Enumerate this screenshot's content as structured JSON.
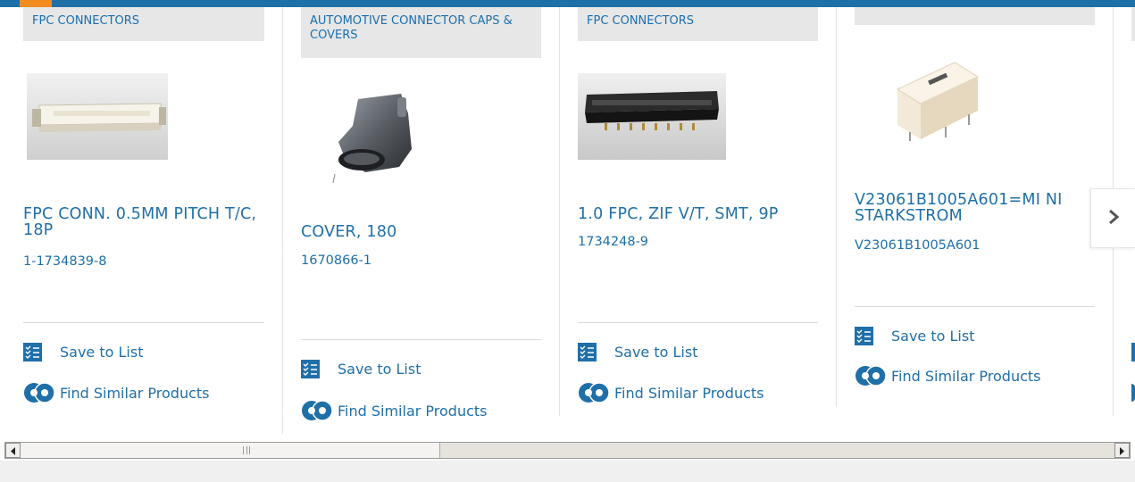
{
  "colors": {
    "brand_blue": "#1f6fa8",
    "accent_orange": "#f28c1e",
    "category_bg": "#e7e7e7"
  },
  "products": [
    {
      "category": "FPC CONNECTORS",
      "title": "FPC CONN. 0.5MM PITCH T/C, 18P",
      "part_number": "1-1734839-8",
      "image_icon": "fpc-connector-image",
      "save_label": "Save to List",
      "find_label": "Find Similar Products"
    },
    {
      "category": "AUTOMOTIVE CONNECTOR CAPS & COVERS",
      "title": "COVER, 180",
      "part_number": "1670866-1",
      "image_icon": "connector-cover-image",
      "save_label": "Save to List",
      "find_label": "Find Similar Products"
    },
    {
      "category": "FPC CONNECTORS",
      "title": "1.0 FPC, ZIF V/T, SMT, 9P",
      "part_number": "1734248-9",
      "image_icon": "zif-connector-image",
      "save_label": "Save to List",
      "find_label": "Find Similar Products"
    },
    {
      "category": "",
      "title": "V23061B1005A601=MI NISTARKSTROM",
      "part_number": "V23061B1005A601",
      "image_icon": "relay-image",
      "save_label": "Save to List",
      "find_label": "Find Similar Products"
    }
  ],
  "carousel": {
    "next_icon": "chevron-right-icon"
  },
  "scrollbar": {
    "left_icon": "arrow-left-icon",
    "right_icon": "arrow-right-icon"
  }
}
